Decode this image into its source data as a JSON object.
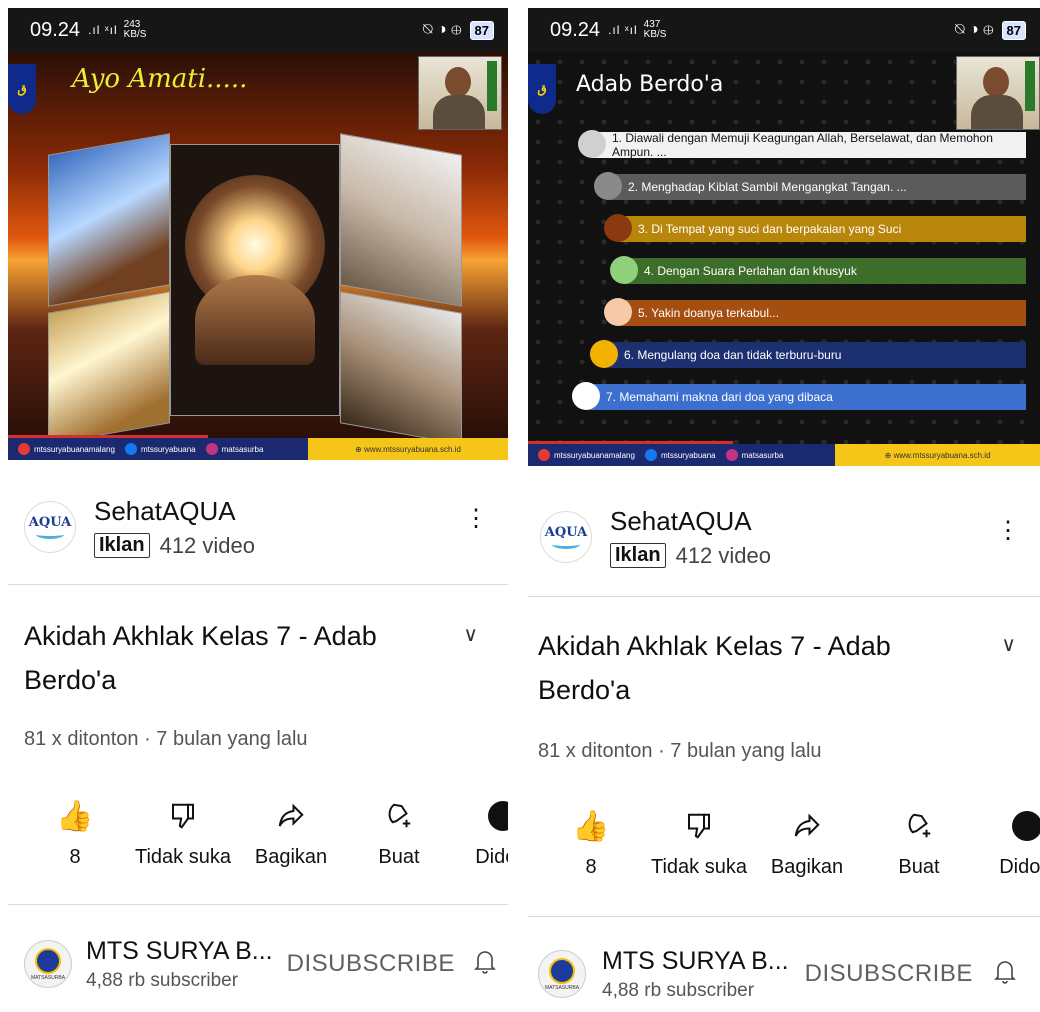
{
  "status": {
    "time": "09.24",
    "signal": ".ıl ˣıl",
    "speed_left": "243",
    "speed_right": "437",
    "speed_unit": "KB/S",
    "icons": "⍉ ◑ ⊕",
    "battery": "87"
  },
  "slide1": {
    "title": "Ayo Amati.....",
    "logo_text": "ق"
  },
  "slide2": {
    "title": "Adab Berdo'a",
    "logo_text": "ق",
    "items": [
      {
        "text": "1. Diawali dengan Memuji Keagungan Allah, Berselawat, dan Memohon Ampun. ...",
        "bar_color": "#f2f2f2",
        "text_color": "#111111",
        "dot_color": "#d0d0d0"
      },
      {
        "text": "2. Menghadap Kiblat Sambil Mengangkat Tangan. ...",
        "bar_color": "#5b5b5b",
        "text_color": "#ffffff",
        "dot_color": "#8a8a8a"
      },
      {
        "text": "3. Di Tempat yang suci dan berpakaian yang Suci",
        "bar_color": "#b8860b",
        "text_color": "#ffffff",
        "dot_color": "#8b3a10"
      },
      {
        "text": "4. Dengan Suara Perlahan dan khusyuk",
        "bar_color": "#3c6e2a",
        "text_color": "#ffffff",
        "dot_color": "#8fd07a"
      },
      {
        "text": "5. Yakin doanya terkabul...",
        "bar_color": "#a44e12",
        "text_color": "#ffffff",
        "dot_color": "#f6c9a8"
      },
      {
        "text": "6. Mengulang doa dan tidak terburu-buru",
        "bar_color": "#1c2f6e",
        "text_color": "#ffffff",
        "dot_color": "#f2b200"
      },
      {
        "text": "7. Memahami makna dari doa yang dibaca",
        "bar_color": "#3d6fcf",
        "text_color": "#ffffff",
        "dot_color": "#ffffff"
      }
    ]
  },
  "footer": {
    "youtube": "mtssuryabuanamalang",
    "facebook": "mtssuryabuana",
    "instagram": "matsasurba",
    "website": "www.mtssuryabuana.sch.id"
  },
  "ad": {
    "logo_text": "AQUA",
    "name": "SehatAQUA",
    "badge": "Iklan",
    "videos": "412 video",
    "menu_icon": "⋮"
  },
  "video": {
    "title": "Akidah Akhlak Kelas 7 - Adab Berdo'a",
    "expand_icon": "∨",
    "meta": "81 x ditonton · 7 bulan yang lalu"
  },
  "actions": {
    "like": {
      "label": "8",
      "icon": "👍"
    },
    "dislike": {
      "label": "Tidak suka"
    },
    "share": {
      "label": "Bagikan",
      "icon": "⇨"
    },
    "create": {
      "label": "Buat"
    },
    "download": {
      "label": "Didow"
    }
  },
  "channel": {
    "name": "MTS SURYA B...",
    "subscribers": "4,88 rb subscriber",
    "button": "DISUBSCRIBE",
    "bell_icon": "🔔",
    "logo_text": "MATSASURBA"
  }
}
